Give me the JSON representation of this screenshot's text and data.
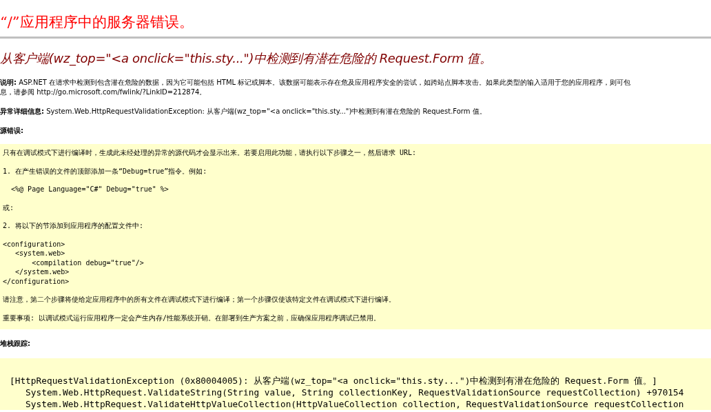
{
  "title": "“/”应用程序中的服务器错误。",
  "heading": "从客户端(wz_top=\"<a onclick=\"this.sty...\")中检测到有潜在危险的 Request.Form 值。",
  "details": [
    "**说明:** ASP.NET 在请求中检测到包含潜在危险的数据，因为它可能包括 HTML 标记或脚本。该数据可能表示存在危及应用程序安全的尝试，如跨站点脚本攻击。如果此类型的输入适用于您的应用程序，则可包",
    "息，请参阅 http://go.microsoft.com/fwlink/?LinkID=212874。",
    "**异常详细信息:** System.Web.HttpRequestValidationException: 从客户端(wz_top=\"<a onclick=\"this.sty...\")中检测到有潜在危险的 Request.Form 值。"
  ],
  "source_error": {
    "heading": "源错误:",
    "paragraphs": [
      "只有在调试模式下进行编译时，生成此未经处理的异常的源代码才会显示出来。若要启用此功能，请执行以下步骤之一，然后请求 URL:",
      "1. 在产生错误的文件的顶部添加一条“Debug=true”指令。例如:",
      "  <%@ Page Language=\"C#\" Debug=\"true\" %>",
      "或:",
      "2. 将以下的节添加到应用程序的配置文件中:",
      "<configuration>\n   <system.web>\n       <compilation debug=\"true\"/>\n   </system.web>\n</configuration>",
      "请注意，第二个步骤将使给定应用程序中的所有文件在调试模式下进行编译；第一个步骤仅使该特定文件在调试模式下进行编译。",
      "重要事项: 以调试模式运行应用程序一定会产生内存/性能系统开销。在部署到生产方案之前，应确保应用程序调试已禁用。"
    ]
  },
  "stack_trace": {
    "heading": "堆栈跟踪:",
    "lines": [
      "[HttpRequestValidationException (0x80004005): 从客户端(wz_top=\"<a onclick=\"this.sty...\")中检测到有潜在危险的 Request.Form 值。]",
      "   System.Web.HttpRequest.ValidateString(String value, String collectionKey, RequestValidationSource requestCollection) +970154",
      "   System.Web.HttpRequest.ValidateHttpValueCollection(HttpValueCollection collection, RequestValidationSource requestCollection"
    ]
  }
}
